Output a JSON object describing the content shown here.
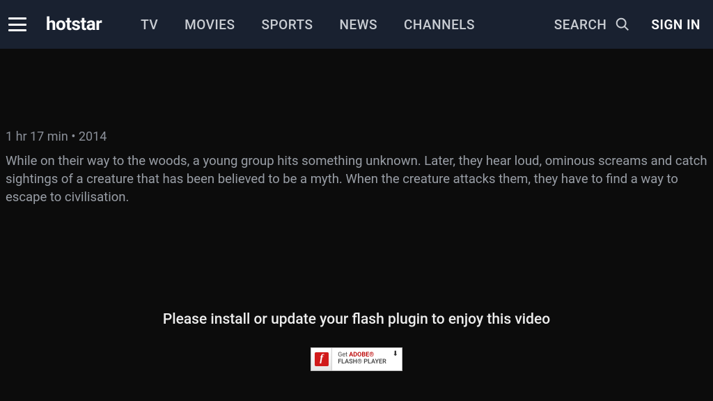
{
  "header": {
    "logo": "hotstar",
    "nav": {
      "tv": "TV",
      "movies": "MOVIES",
      "sports": "SPORTS",
      "news": "NEWS",
      "channels": "CHANNELS"
    },
    "search": "SEARCH",
    "signin": "SIGN IN"
  },
  "content": {
    "meta": "1 hr 17 min • 2014",
    "description": "While on their way to the woods, a young group hits something unknown. Later, they hear loud, ominous screams and catch sightings of a creature that has been believed to be a myth. When the creature attacks them, they have to find a way to escape to civilisation."
  },
  "player": {
    "flash_message": "Please install or update your flash plugin to enjoy this video",
    "flash_badge_line1_pre": "Get ",
    "flash_badge_line1_adobe": "ADOBE®",
    "flash_badge_line2": "FLASH® PLAYER"
  }
}
